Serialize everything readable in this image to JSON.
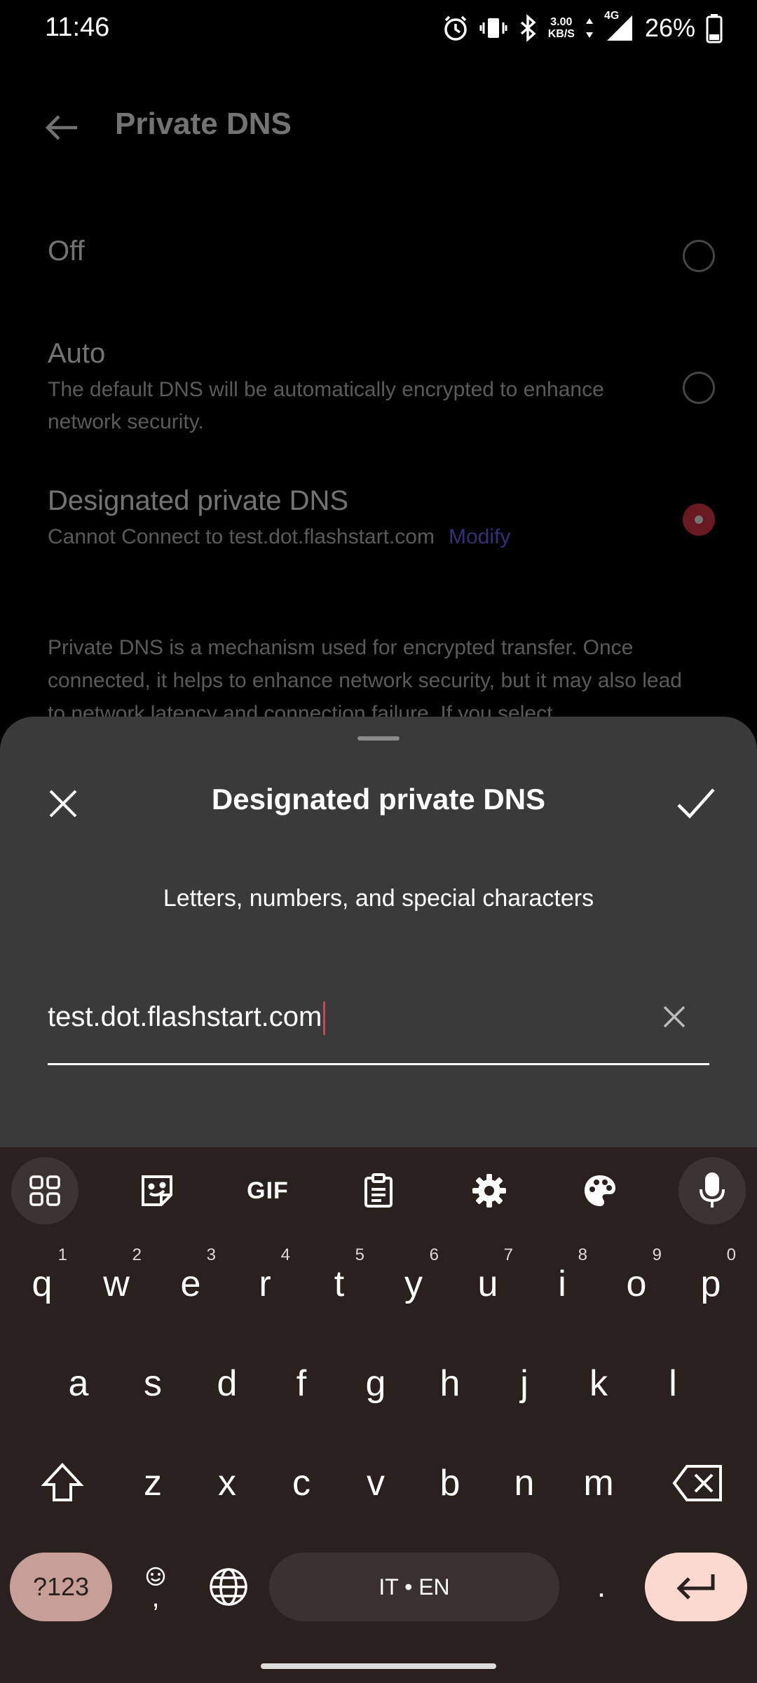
{
  "status_bar": {
    "time": "11:46",
    "net_speed_value": "3.00",
    "net_speed_unit": "KB/S",
    "network": "4G",
    "battery": "26%",
    "icons": [
      "alarm-icon",
      "vibrate-icon",
      "bluetooth-icon",
      "data-arrows-icon",
      "signal-icon",
      "battery-icon"
    ]
  },
  "page": {
    "title": "Private DNS",
    "options": [
      {
        "label": "Off",
        "description": "",
        "selected": false
      },
      {
        "label": "Auto",
        "description": "The default DNS will be automatically encrypted to enhance network security.",
        "selected": false
      },
      {
        "label": "Designated private DNS",
        "description": "Cannot Connect to test.dot.flashstart.com",
        "link": "Modify",
        "selected": true
      }
    ],
    "info": "Private DNS is a mechanism used for encrypted transfer. Once connected, it helps to enhance network security, but it may also lead to network latency and connection failure. If you select"
  },
  "sheet": {
    "title": "Designated private DNS",
    "hint": "Letters, numbers, and special characters",
    "input_value": "test.dot.flashstart.com"
  },
  "keyboard": {
    "toolbar": [
      "apps-grid-icon",
      "sticker-icon",
      "GIF",
      "clipboard-icon",
      "settings-icon",
      "palette-icon",
      "mic-icon"
    ],
    "row1": [
      "q",
      "w",
      "e",
      "r",
      "t",
      "y",
      "u",
      "i",
      "o",
      "p"
    ],
    "row1_hints": [
      "1",
      "2",
      "3",
      "4",
      "5",
      "6",
      "7",
      "8",
      "9",
      "0"
    ],
    "row2": [
      "a",
      "s",
      "d",
      "f",
      "g",
      "h",
      "j",
      "k",
      "l"
    ],
    "row3": [
      "z",
      "x",
      "c",
      "v",
      "b",
      "n",
      "m"
    ],
    "symbols_label": "?123",
    "comma_label": ",",
    "space_label": "IT • EN",
    "period_label": "."
  },
  "colors": {
    "accent": "#e8394b",
    "link": "#6a72ff",
    "sheet_bg": "#3a3a3b",
    "keyboard_bg": "#2a211f",
    "enter_key": "#fbd9d1",
    "symbols_key": "#c79f98"
  }
}
